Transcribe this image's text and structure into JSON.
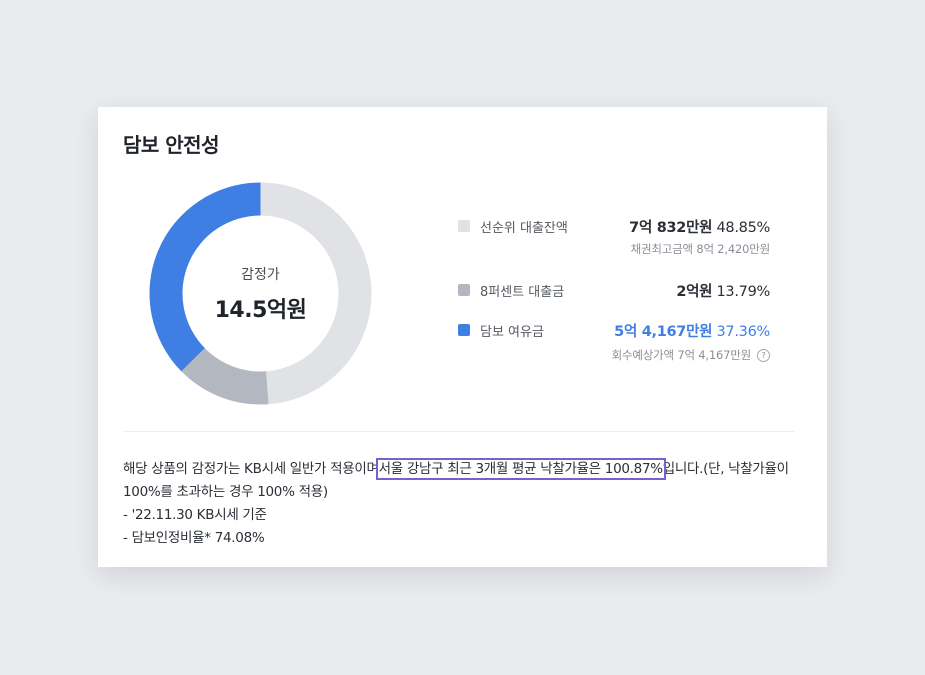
{
  "title": "담보 안전성",
  "donut": {
    "center_label": "감정가",
    "center_value": "14.5억원",
    "segments": [
      {
        "name": "선순위 대출잔액",
        "percent": 48.85,
        "color": "#e0e2e6"
      },
      {
        "name": "8퍼센트 대출금",
        "percent": 13.79,
        "color": "#b3b8c0"
      },
      {
        "name": "담보 여유금",
        "percent": 37.36,
        "color": "#3f7fe3"
      }
    ]
  },
  "legend": {
    "item1": {
      "name": "선순위 대출잔액",
      "amount": "7억 832만원",
      "percent": "48.85%",
      "sub": "채권최고금액 8억 2,420만원"
    },
    "item2": {
      "name": "8퍼센트 대출금",
      "amount": "2억원",
      "percent": "13.79%"
    },
    "item3": {
      "name": "담보 여유금",
      "amount": "5억 4,167만원",
      "percent": "37.36%",
      "sub": "회수예상가액 7억 4,167만원",
      "help_symbol": "?"
    }
  },
  "description": {
    "line1_pre": "해당 상품의 감정가는 KB시세 일반가 적용이며",
    "line1_highlight": "서울 강남구 최근 3개월 평균 낙찰가율은 100.87%",
    "line1_post": "입니다.(단, 낙찰가율이 100%를 초과하는 경우 100% 적용)",
    "line2": "- '22.11.30 KB시세 기준",
    "line3": "- 담보인정비율* 74.08%"
  }
}
